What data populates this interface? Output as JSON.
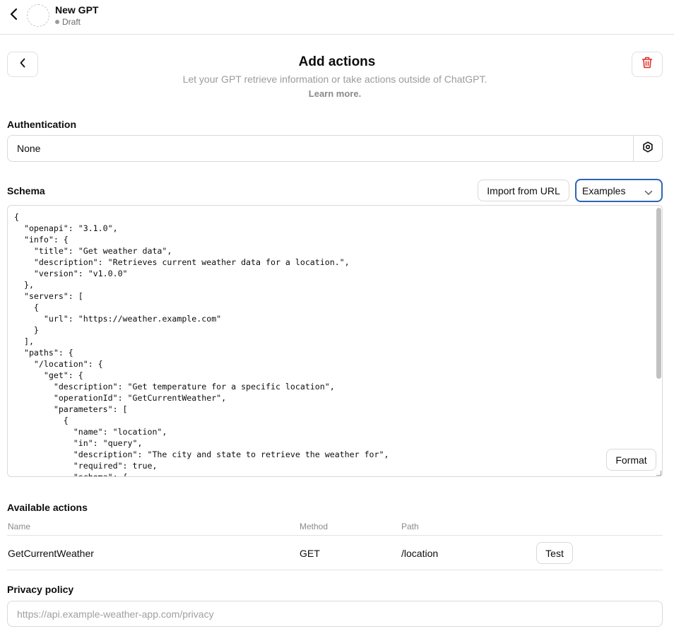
{
  "topbar": {
    "gpt_name": "New GPT",
    "status": "Draft"
  },
  "header": {
    "title": "Add actions",
    "subtitle": "Let your GPT retrieve information or take actions outside of ChatGPT.",
    "learn_more": "Learn more."
  },
  "authentication": {
    "label": "Authentication",
    "value": "None"
  },
  "schema": {
    "label": "Schema",
    "import_button": "Import from URL",
    "examples_select": "Examples",
    "format_button": "Format",
    "code": "{\n  \"openapi\": \"3.1.0\",\n  \"info\": {\n    \"title\": \"Get weather data\",\n    \"description\": \"Retrieves current weather data for a location.\",\n    \"version\": \"v1.0.0\"\n  },\n  \"servers\": [\n    {\n      \"url\": \"https://weather.example.com\"\n    }\n  ],\n  \"paths\": {\n    \"/location\": {\n      \"get\": {\n        \"description\": \"Get temperature for a specific location\",\n        \"operationId\": \"GetCurrentWeather\",\n        \"parameters\": [\n          {\n            \"name\": \"location\",\n            \"in\": \"query\",\n            \"description\": \"The city and state to retrieve the weather for\",\n            \"required\": true,\n            \"schema\": {"
  },
  "available_actions": {
    "label": "Available actions",
    "columns": {
      "name": "Name",
      "method": "Method",
      "path": "Path"
    },
    "rows": [
      {
        "name": "GetCurrentWeather",
        "method": "GET",
        "path": "/location",
        "test_label": "Test"
      }
    ]
  },
  "privacy": {
    "label": "Privacy policy",
    "placeholder": "https://api.example-weather-app.com/privacy"
  },
  "colors": {
    "delete_icon": "#e02e2a",
    "select_focus_border": "#2e63b8"
  }
}
